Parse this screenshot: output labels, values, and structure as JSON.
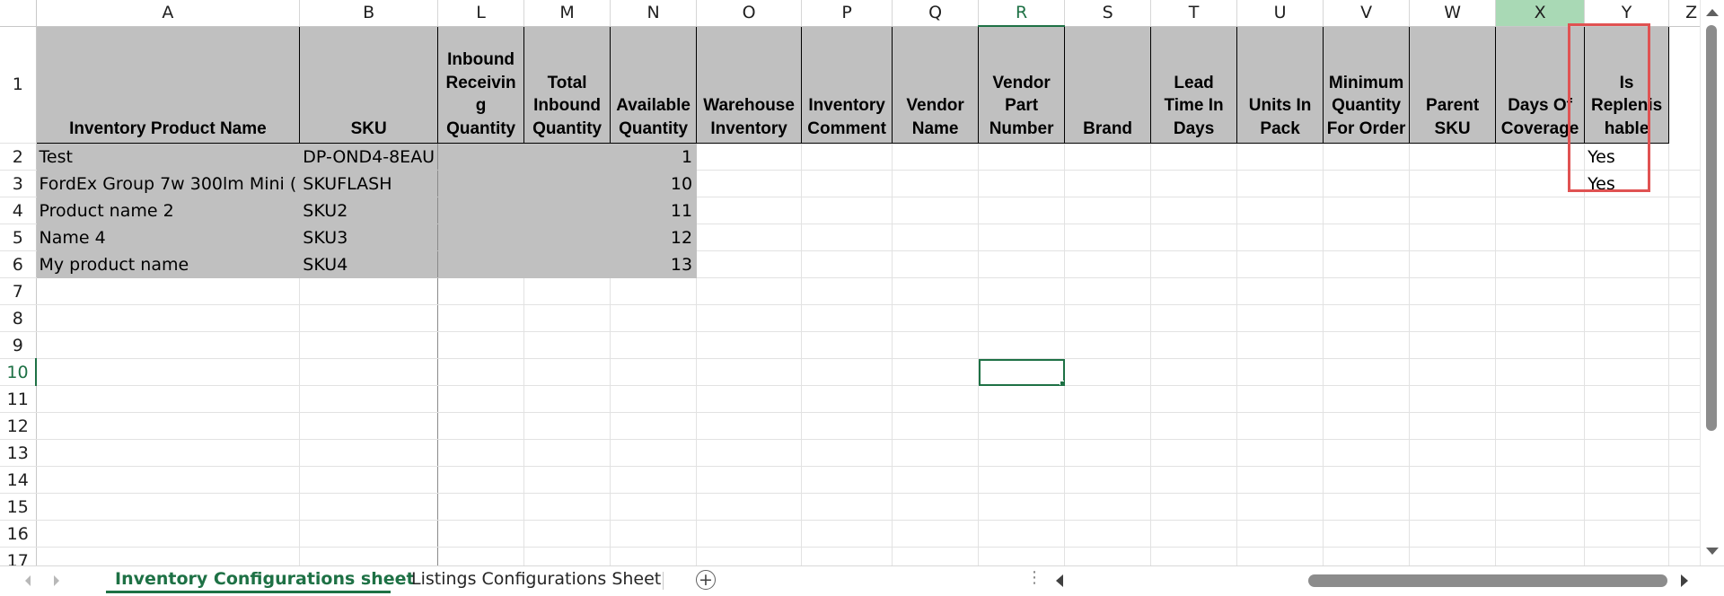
{
  "columns": [
    "A",
    "B",
    "L",
    "M",
    "N",
    "O",
    "P",
    "Q",
    "R",
    "S",
    "T",
    "U",
    "V",
    "W",
    "X",
    "Y",
    "Z"
  ],
  "active_column": "R",
  "selected_column": "X",
  "row_numbers": [
    "1",
    "2",
    "3",
    "4",
    "5",
    "6",
    "7",
    "8",
    "9",
    "10",
    "11",
    "12",
    "13",
    "14",
    "15",
    "16",
    "17"
  ],
  "active_row": "10",
  "headers": {
    "A": "Inventory Product Name",
    "B": "SKU",
    "L": "Inbound Receivin g Quantity",
    "M": "Total Inbound Quantity",
    "N": "Available Quantity",
    "O": "Warehouse Inventory",
    "P": "Inventory Comment",
    "Q": "Vendor Name",
    "R": "Vendor Part Number",
    "S": "Brand",
    "T": "Lead Time In Days",
    "U": "Units In Pack",
    "V": "Minimum Quantity For Order",
    "W": "Parent SKU",
    "X": "Days Of Coverage",
    "Y": "Is Replenis hable"
  },
  "rows": [
    {
      "name": "Test",
      "sku": "DP-OND4-8EAU",
      "available": "1",
      "replenishable": "Yes"
    },
    {
      "name": "FordEx Group 7w 300lm Mini (",
      "sku": "SKUFLASH",
      "available": "10",
      "replenishable": "Yes"
    },
    {
      "name": "Product name 2",
      "sku": "SKU2",
      "available": "11",
      "replenishable": ""
    },
    {
      "name": "Name 4",
      "sku": "SKU3",
      "available": "12",
      "replenishable": ""
    },
    {
      "name": "My product name",
      "sku": "SKU4",
      "available": "13",
      "replenishable": ""
    }
  ],
  "tabs": {
    "active": "Inventory Configurations sheet",
    "other": "Listings Configurations Sheet",
    "add_symbol": "+",
    "dots": "⋮"
  },
  "colors": {
    "header_fill": "#c0c0c0",
    "accent_green": "#1e7145",
    "highlight_red": "#e05252",
    "selected_column_fill": "#a9d9b5"
  }
}
